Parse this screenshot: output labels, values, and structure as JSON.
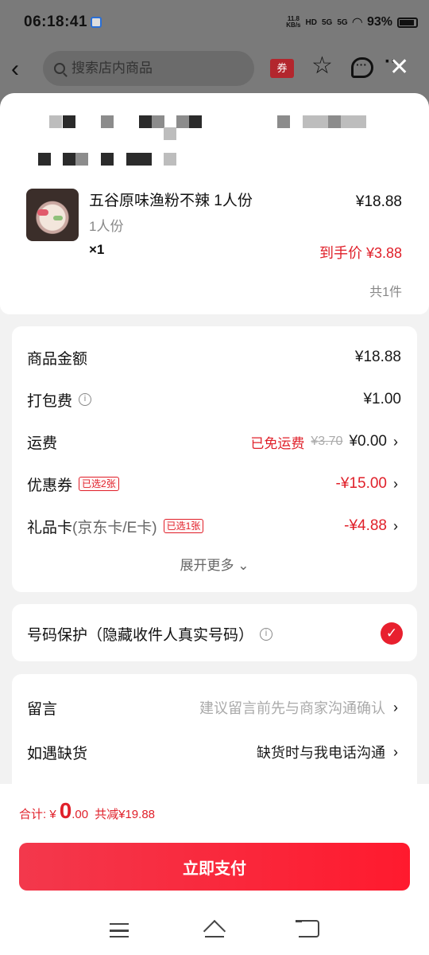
{
  "status_bar": {
    "time": "06:18:41",
    "speed": "11.8",
    "speed_unit": "KB/s",
    "net1": "HD",
    "net2": "5G",
    "net3": "5G",
    "battery": "93%"
  },
  "nav": {
    "search_placeholder": "搜索店内商品",
    "coupon_label": "券"
  },
  "product": {
    "name": "五谷原味渔粉不辣 1人份",
    "spec": "1人份",
    "qty": "×1",
    "price": "¥18.88",
    "final_price": "到手价 ¥3.88",
    "count": "共1件"
  },
  "fees": {
    "goods_label": "商品金额",
    "goods_value": "¥18.88",
    "packing_label": "打包费",
    "packing_value": "¥1.00",
    "shipping_label": "运费",
    "shipping_note": "已免运费",
    "shipping_original": "¥3.70",
    "shipping_value": "¥0.00",
    "coupon_label": "优惠券",
    "coupon_badge": "已选2张",
    "coupon_value": "-¥15.00",
    "giftcard_label": "礼品卡",
    "giftcard_sub": "(京东卡/E卡)",
    "giftcard_badge": "已选1张",
    "giftcard_value": "-¥4.88",
    "expand_label": "展开更多"
  },
  "privacy": {
    "label": "号码保护（隐藏收件人真实号码）"
  },
  "notes": {
    "message_label": "留言",
    "message_placeholder": "建议留言前先与商家沟通确认",
    "stockout_label": "如遇缺货",
    "stockout_value": "缺货时与我电话沟通"
  },
  "bottom": {
    "total_prefix": "合计: ¥",
    "total_int": "0",
    "total_dec": ".00",
    "discount": "共减¥19.88",
    "pay_label": "立即支付"
  },
  "colors": {
    "accent_red": "#e0202a",
    "pay_gradient_start": "#f3384c",
    "pay_gradient_end": "#ff1a2e"
  }
}
